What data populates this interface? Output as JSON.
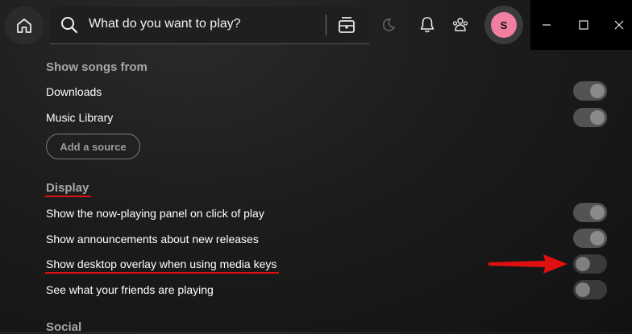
{
  "search": {
    "placeholder": "What do you want to play?"
  },
  "avatar": {
    "initial": "S",
    "color": "#f07fa0"
  },
  "sections": {
    "show_songs_from": {
      "title": "Show songs from",
      "items": [
        {
          "label": "Downloads",
          "toggle": "on"
        },
        {
          "label": "Music Library",
          "toggle": "on"
        }
      ],
      "add_source_label": "Add a source"
    },
    "display": {
      "title": "Display",
      "items": [
        {
          "label": "Show the now-playing panel on click of play",
          "toggle": "on"
        },
        {
          "label": "Show announcements about new releases",
          "toggle": "on"
        },
        {
          "label": "Show desktop overlay when using media keys",
          "toggle": "off"
        },
        {
          "label": "See what your friends are playing",
          "toggle": "off"
        }
      ]
    },
    "social": {
      "title": "Social"
    }
  },
  "annotation_color": "#e01010",
  "icons": [
    "home-icon",
    "search-icon",
    "browse-icon",
    "moon-icon",
    "bell-icon",
    "friends-icon",
    "minimize-icon",
    "maximize-icon",
    "close-icon",
    "arrow-annotation"
  ]
}
